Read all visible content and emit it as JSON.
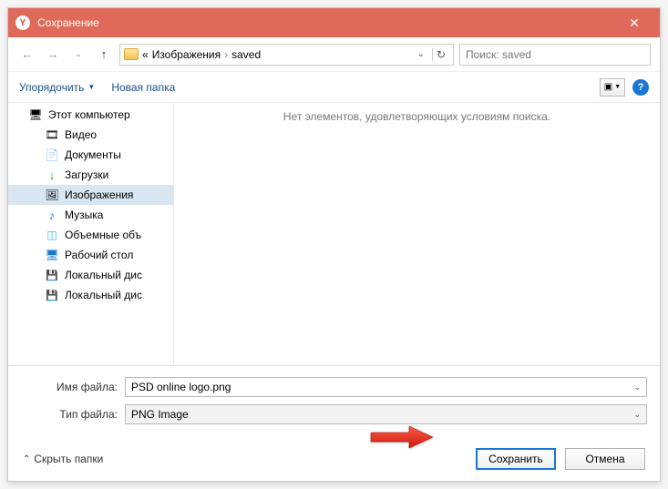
{
  "title": "Сохранение",
  "breadcrumb": {
    "prefix": "«",
    "part1": "Изображения",
    "part2": "saved"
  },
  "search": {
    "placeholder": "Поиск: saved"
  },
  "toolbar": {
    "organize": "Упорядочить",
    "newfolder": "Новая папка",
    "help": "?"
  },
  "sidebar": {
    "items": [
      {
        "label": "Этот компьютер",
        "icon": "ico-computer",
        "child": false
      },
      {
        "label": "Видео",
        "icon": "ico-video",
        "child": true
      },
      {
        "label": "Документы",
        "icon": "ico-doc",
        "child": true
      },
      {
        "label": "Загрузки",
        "icon": "ico-download",
        "child": true
      },
      {
        "label": "Изображения",
        "icon": "ico-image",
        "child": true,
        "selected": true
      },
      {
        "label": "Музыка",
        "icon": "ico-music",
        "child": true
      },
      {
        "label": "Объемные объ",
        "icon": "ico-3d",
        "child": true
      },
      {
        "label": "Рабочий стол",
        "icon": "ico-desktop",
        "child": true
      },
      {
        "label": "Локальный дис",
        "icon": "ico-disk",
        "child": true
      },
      {
        "label": "Локальный дис",
        "icon": "ico-disk",
        "child": true
      }
    ]
  },
  "content": {
    "empty": "Нет элементов, удовлетворяющих условиям поиска."
  },
  "form": {
    "filename_label": "Имя файла:",
    "filename_value": "PSD online logo.png",
    "filetype_label": "Тип файла:",
    "filetype_value": "PNG Image"
  },
  "footer": {
    "hide": "Скрыть папки",
    "save": "Сохранить",
    "cancel": "Отмена"
  }
}
